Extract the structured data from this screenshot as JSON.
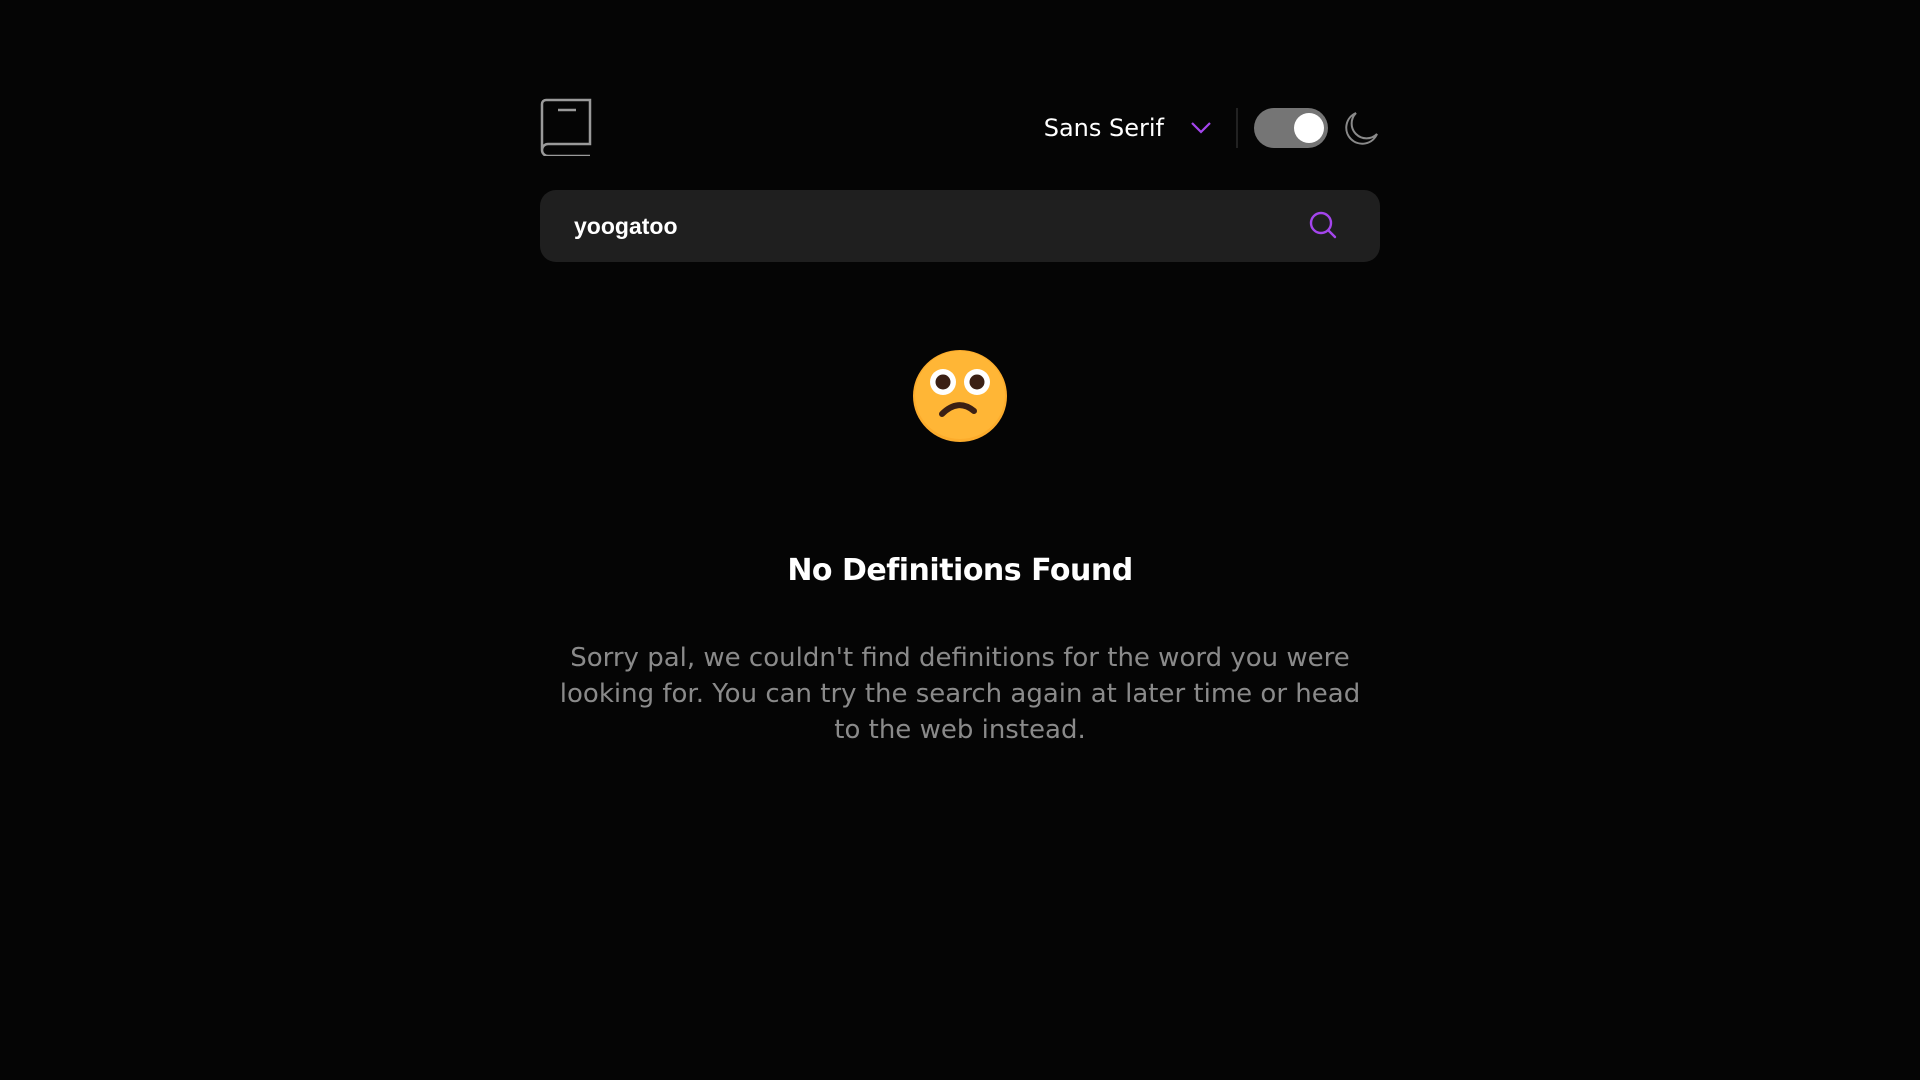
{
  "header": {
    "logo_icon": "book-icon",
    "font_selector": {
      "selected": "Sans Serif",
      "icon": "chevron-down-icon"
    },
    "theme_toggle": {
      "state": "on",
      "icon": "moon-icon"
    }
  },
  "search": {
    "value": "yoogatoo",
    "icon": "search-icon"
  },
  "empty_state": {
    "emoji": "confused-face",
    "title": "No Definitions Found",
    "message": "Sorry pal, we couldn't find definitions for the word you were looking for. You can try the search again at later time or head to the web instead."
  },
  "colors": {
    "background": "#050505",
    "accent": "#a445ed",
    "search_bg": "#1f1f1f",
    "toggle_bg": "#757575",
    "muted_text": "#8a8a8a"
  }
}
